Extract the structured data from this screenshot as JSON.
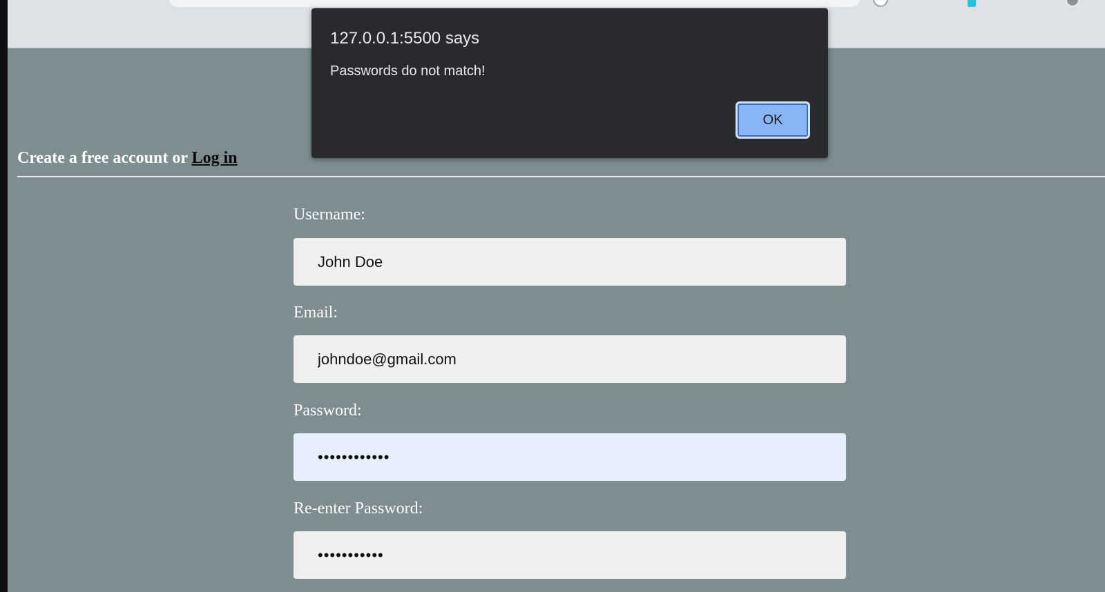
{
  "dialog": {
    "title": "127.0.0.1:5500 says",
    "message": "Passwords do not match!",
    "ok_label": "OK"
  },
  "header": {
    "text": "Create a free account or ",
    "login_link": "Log in"
  },
  "form": {
    "username": {
      "label": "Username:",
      "value": "John Doe"
    },
    "email": {
      "label": "Email:",
      "value": "johndoe@gmail.com"
    },
    "password": {
      "label": "Password:",
      "value": "••••••••••••"
    },
    "reenter_password": {
      "label": "Re-enter Password:",
      "value": "•••••••••••"
    }
  },
  "colors": {
    "page_background": "#7e8d8f",
    "dialog_background": "#292a2d",
    "ok_button": "#8ab4f8",
    "input_background": "#eff0ef",
    "autofill_background": "#e8effc"
  }
}
